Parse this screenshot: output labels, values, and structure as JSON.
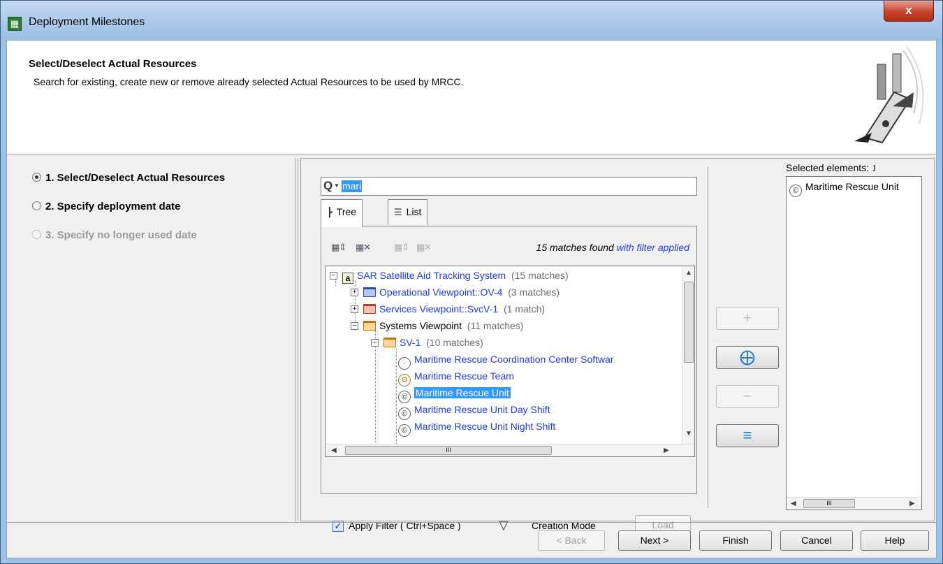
{
  "window": {
    "title": "Deployment Milestones",
    "close_label": "x"
  },
  "header": {
    "title": "Select/Deselect Actual Resources",
    "description": "Search for existing, create new or remove already selected Actual Resources to be used by MRCC."
  },
  "steps": [
    {
      "label": "1. Select/Deselect Actual Resources",
      "state": "selected"
    },
    {
      "label": "2. Specify deployment date",
      "state": "enabled"
    },
    {
      "label": "3. Specify no longer used date",
      "state": "disabled"
    }
  ],
  "search": {
    "value": "mari",
    "icon": "search-icon"
  },
  "tabs": [
    {
      "label": "Tree",
      "icon": "tree-icon",
      "active": true
    },
    {
      "label": "List",
      "icon": "list-icon",
      "active": false
    }
  ],
  "matches": {
    "prefix": "15 matches found",
    "suffix": " with filter applied"
  },
  "tree": [
    {
      "label": "SAR Satellite Aid Tracking System",
      "count": "(15 matches)",
      "icon": "model-icon"
    },
    {
      "label": "Operational Viewpoint::OV-4",
      "count": "(3 matches)",
      "icon": "folder-blue-icon"
    },
    {
      "label": "Services Viewpoint::SvcV-1",
      "count": "(1 match)",
      "icon": "folder-red-icon"
    },
    {
      "label": "Systems Viewpoint",
      "count": "(11 matches)",
      "icon": "folder-orange-icon"
    },
    {
      "label": "SV-1",
      "count": "(10 matches)",
      "icon": "folder-orange-icon"
    },
    {
      "label": "Maritime Rescue Coordination Center Softwar",
      "icon": "software-icon"
    },
    {
      "label": "Maritime Rescue Team",
      "icon": "team-icon"
    },
    {
      "label": "Maritime Rescue Unit",
      "icon": "resource-icon",
      "selected": true
    },
    {
      "label": "Maritime Rescue Unit Day Shift",
      "icon": "resource-icon"
    },
    {
      "label": "Maritime Rescue Unit Night Shift",
      "icon": "resource-icon"
    }
  ],
  "filter": {
    "apply_label": "Apply Filter ( Ctrl+Space )",
    "checked": true,
    "creation_mode_label": "Creation Mode",
    "load_label": "Load"
  },
  "selected": {
    "label_prefix": "Selected elements: ",
    "count": "1",
    "items": [
      "Maritime Rescue Unit"
    ]
  },
  "scroll_glyph": "III",
  "footer": {
    "back_label": "< Back",
    "next_label": "Next >",
    "finish_label": "Finish",
    "cancel_label": "Cancel",
    "help_label": "Help"
  }
}
